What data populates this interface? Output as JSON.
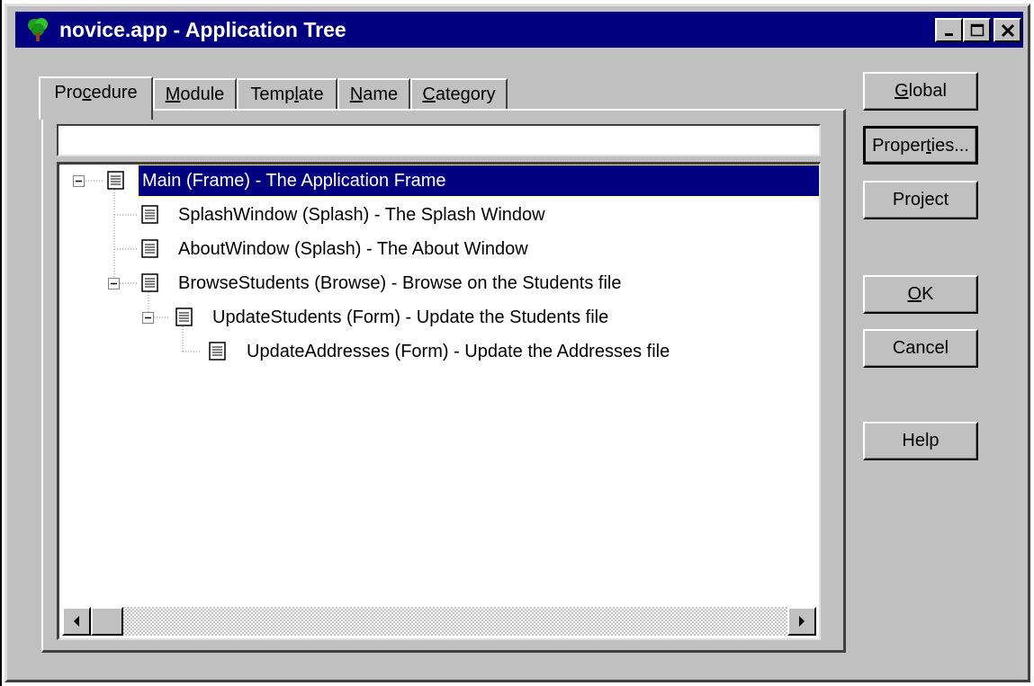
{
  "window": {
    "title": "novice.app - Application Tree",
    "icon": "tree-icon",
    "caption_buttons": [
      "minimize",
      "maximize",
      "close"
    ]
  },
  "tabs": [
    {
      "pre": "Pro",
      "u": "c",
      "post": "edure",
      "active": true
    },
    {
      "pre": "",
      "u": "M",
      "post": "odule",
      "active": false
    },
    {
      "pre": "Temp",
      "u": "l",
      "post": "ate",
      "active": false
    },
    {
      "pre": "",
      "u": "N",
      "post": "ame",
      "active": false
    },
    {
      "pre": "",
      "u": "C",
      "post": "ategory",
      "active": false
    }
  ],
  "locator": {
    "value": ""
  },
  "tree": [
    {
      "label": "Main (Frame) - The Application Frame",
      "selected": true
    },
    {
      "label": "SplashWindow (Splash) - The Splash Window"
    },
    {
      "label": "AboutWindow (Splash) - The About Window"
    },
    {
      "label": "BrowseStudents (Browse) - Browse on the Students file"
    },
    {
      "label": "UpdateStudents (Form) - Update the Students file"
    },
    {
      "label": "UpdateAddresses (Form) - Update the Addresses file"
    }
  ],
  "buttons": {
    "global": {
      "pre": "",
      "u": "G",
      "post": "lobal"
    },
    "properties": {
      "pre": "Proper",
      "u": "t",
      "post": "ies..."
    },
    "project": {
      "label": "Project"
    },
    "ok": {
      "pre": "",
      "u": "O",
      "post": "K"
    },
    "cancel": {
      "label": "Cancel"
    },
    "help": {
      "label": "Help"
    }
  },
  "colors": {
    "title_bar": "#000080",
    "face": "#c0c0c0",
    "selection": "#000080"
  }
}
